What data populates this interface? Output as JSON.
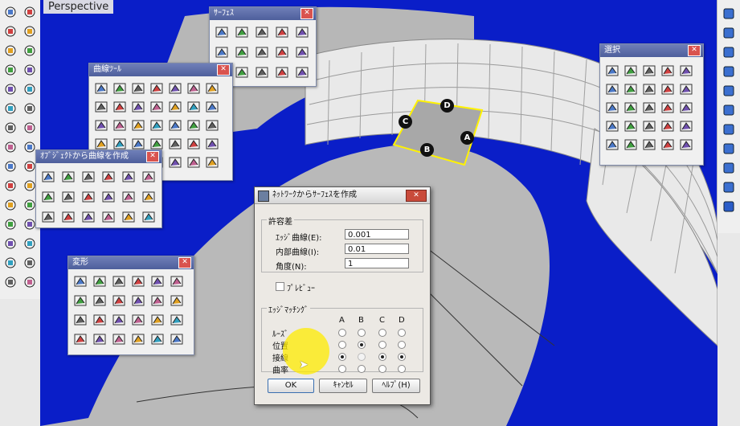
{
  "viewport": {
    "label": "Perspective"
  },
  "points": [
    "A",
    "B",
    "C",
    "D"
  ],
  "palettes": {
    "surface": {
      "title": "ｻｰﾌｪｽ"
    },
    "curve_tools": {
      "title": "曲線ﾂｰﾙ"
    },
    "curve_from_objects": {
      "title": "ｵﾌﾞｼﾞｪｸﾄから曲線を作成"
    },
    "transform": {
      "title": "変形"
    },
    "select": {
      "title": "選択"
    }
  },
  "dialog": {
    "title": "ﾈｯﾄﾜｰｸからｻｰﾌｪｽを作成",
    "tolerance_group": "許容差",
    "fields": [
      {
        "label": "ｴｯｼﾞ曲線(E):",
        "value": "0.001"
      },
      {
        "label": "内部曲線(I):",
        "value": "0.01"
      },
      {
        "label": "角度(N):",
        "value": "1"
      }
    ],
    "preview_label": "ﾌﾟﾚﾋﾞｭｰ",
    "edge_group": "ｴｯｼﾞﾏｯﾁﾝｸﾞ",
    "columns": [
      "A",
      "B",
      "C",
      "D"
    ],
    "rows": [
      {
        "label": "ﾙｰｽﾞ",
        "selected": -1
      },
      {
        "label": "位置",
        "selected": 1
      },
      {
        "label": "接線",
        "selected": 0
      },
      {
        "label": "曲率",
        "selected": -1
      }
    ],
    "ok_label": "OK",
    "cancel_label": "ｷｬﾝｾﾙ",
    "help_label": "ﾍﾙﾌﾟ(H)"
  },
  "colors": {
    "viewport_bg": "#0a1ec8",
    "surface_gray": "#b8b8b8",
    "highlight": "#fff200"
  }
}
